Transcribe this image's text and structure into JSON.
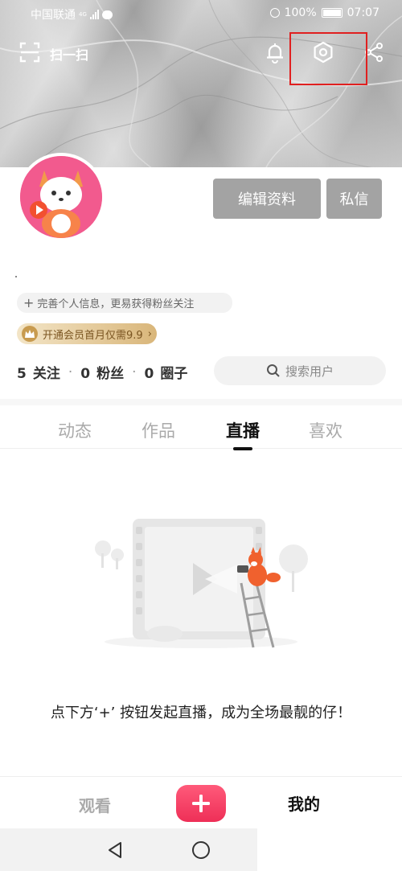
{
  "status_bar": {
    "carrier": "中国联通",
    "network": "4G",
    "battery": "100%",
    "time": "07:07"
  },
  "toolbar": {
    "scan_label": "扫一扫",
    "icons": [
      "scan-icon",
      "bell-icon",
      "settings-icon",
      "share-icon"
    ]
  },
  "profile": {
    "edit_button": "编辑资料",
    "message_button": "私信",
    "complete_info": "完善个人信息，更易获得粉丝关注",
    "vip_promo": "开通会员首月仅需9.9",
    "stats": {
      "following_count": "5",
      "following_label": "关注",
      "fans_count": "0",
      "fans_label": "粉丝",
      "circles_count": "0",
      "circles_label": "圈子"
    },
    "search_placeholder": "搜索用户"
  },
  "tabs": [
    {
      "label": "动态",
      "active": false
    },
    {
      "label": "作品",
      "active": false
    },
    {
      "label": "直播",
      "active": true
    },
    {
      "label": "喜欢",
      "active": false
    }
  ],
  "empty_state": {
    "text": "点下方‘+’ 按钮发起直播，成为全场最靓的仔！"
  },
  "bottom_nav": {
    "watch": "观看",
    "me": "我的"
  },
  "colors": {
    "accent": "#ee2f57",
    "button_gray": "#a3a3a3",
    "highlight": "#e02020",
    "avatar_bg": "#f25a8e"
  }
}
